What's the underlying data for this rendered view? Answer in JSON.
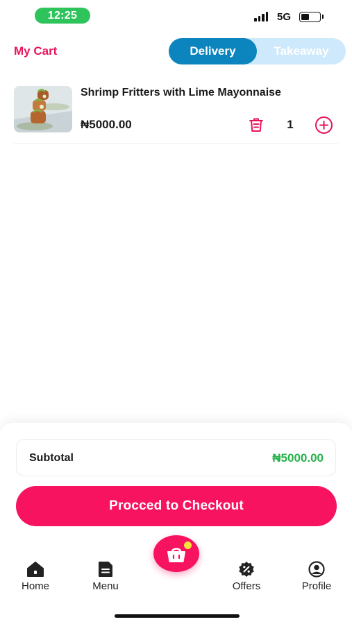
{
  "status_bar": {
    "time": "12:25",
    "network": "5G",
    "battery_level": 0.45
  },
  "header": {
    "title": "My Cart",
    "toggle": {
      "options": [
        "Delivery",
        "Takeaway"
      ],
      "selected": "Delivery"
    }
  },
  "cart": {
    "items": [
      {
        "name": "Shrimp Fritters with Lime Mayonnaise",
        "price": "₦5000.00",
        "quantity": "1",
        "image": "shrimp-fritters-photo"
      }
    ]
  },
  "summary": {
    "subtotal_label": "Subtotal",
    "subtotal_value": "₦5000.00"
  },
  "checkout_label": "Procced to Checkout",
  "tabbar": {
    "items": [
      {
        "label": "Home",
        "icon": "home-icon"
      },
      {
        "label": "Menu",
        "icon": "menu-icon"
      },
      {
        "label": "Offers",
        "icon": "offers-icon"
      },
      {
        "label": "Profile",
        "icon": "profile-icon"
      }
    ],
    "center_icon": "cart-basket-icon"
  },
  "colors": {
    "brand_pink": "#f7135f",
    "delivery_blue": "#0c84bd",
    "takeaway_bg": "#cde9fb",
    "price_green": "#25b24a"
  }
}
